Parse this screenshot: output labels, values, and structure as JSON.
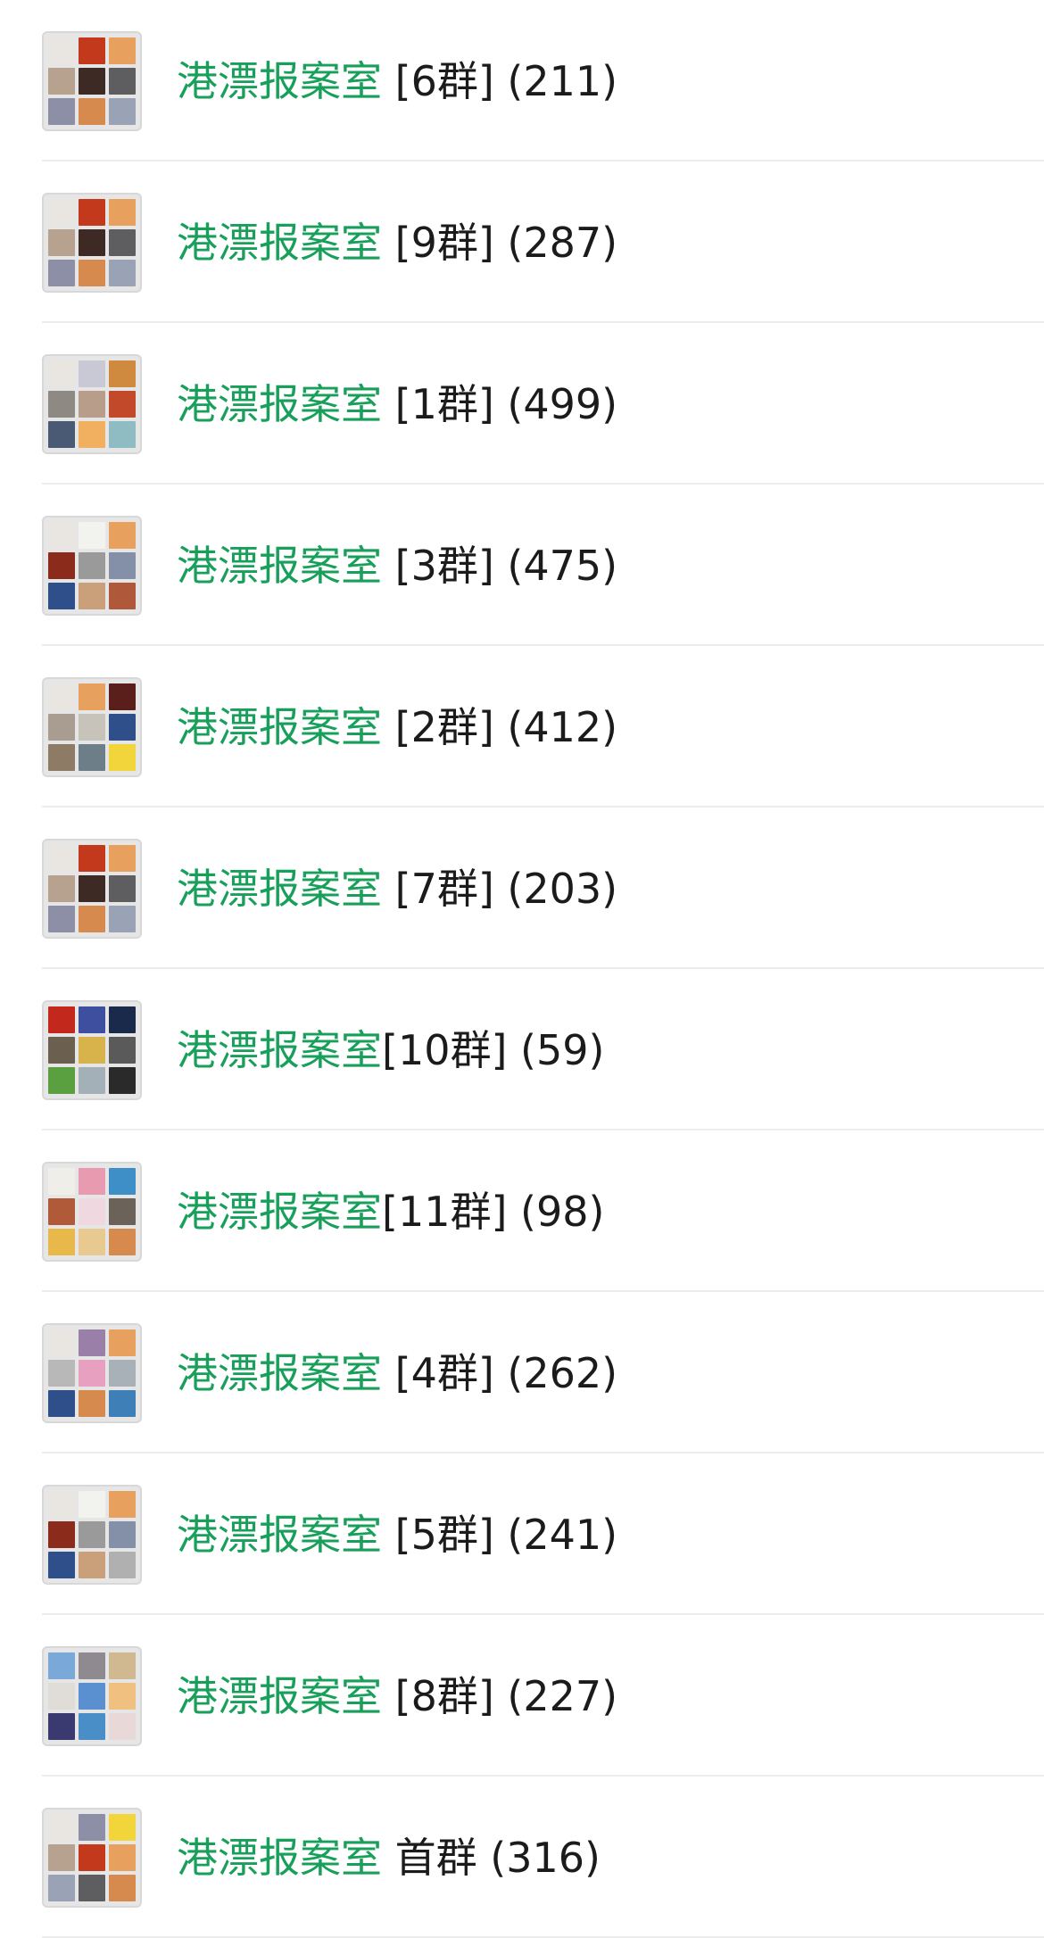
{
  "accent_color": "#18a05b",
  "text_color": "#1b1b1b",
  "groups": [
    {
      "name": "港漂报案室",
      "tag": " [6群]",
      "count": " (211)",
      "avatar_colors": [
        "#e9e6e1",
        "#c2391c",
        "#e7a05e",
        "#b6a28f",
        "#3d2a25",
        "#5e5e60",
        "#8d8fa6",
        "#d68a4e",
        "#9aa3b5"
      ]
    },
    {
      "name": "港漂报案室",
      "tag": " [9群]",
      "count": " (287)",
      "avatar_colors": [
        "#e9e6e1",
        "#c2391c",
        "#e7a05e",
        "#b6a28f",
        "#3d2a25",
        "#5e5e60",
        "#8d8fa6",
        "#d68a4e",
        "#9aa3b5"
      ]
    },
    {
      "name": "港漂报案室",
      "tag": " [1群]",
      "count": " (499)",
      "avatar_colors": [
        "#e9e6e1",
        "#c9c9d6",
        "#d08a3f",
        "#8e8a83",
        "#b89d8a",
        "#c24a2a",
        "#4a5a75",
        "#f0b060",
        "#8fbcc3"
      ]
    },
    {
      "name": "港漂报案室",
      "tag": " [3群]",
      "count": " (475)",
      "avatar_colors": [
        "#e9e6e1",
        "#f2f2ee",
        "#e7a05e",
        "#8b2b1c",
        "#9a9a9a",
        "#8390a8",
        "#2e4f8a",
        "#c9a07a",
        "#b0583a"
      ]
    },
    {
      "name": "港漂报案室",
      "tag": " [2群]",
      "count": " (412)",
      "avatar_colors": [
        "#e9e6e1",
        "#e7a05e",
        "#5a1f1a",
        "#a89d90",
        "#c7c2ba",
        "#2e4f8a",
        "#8d7b66",
        "#6d7e89",
        "#f2d53a"
      ]
    },
    {
      "name": "港漂报案室",
      "tag": " [7群]",
      "count": " (203)",
      "avatar_colors": [
        "#e9e6e1",
        "#c2391c",
        "#e7a05e",
        "#b6a28f",
        "#3d2a25",
        "#5e5e60",
        "#8d8fa6",
        "#d68a4e",
        "#9aa3b5"
      ]
    },
    {
      "name": "港漂报案室",
      "tag": "[10群]",
      "count": " (59)",
      "avatar_colors": [
        "#c2291c",
        "#3f4fa0",
        "#1a2a4a",
        "#6b6050",
        "#d8b24a",
        "#5a5a5a",
        "#5aa040",
        "#a3b0b8",
        "#2a2a2a"
      ]
    },
    {
      "name": "港漂报案室",
      "tag": "[11群]",
      "count": " (98)",
      "avatar_colors": [
        "#f0eee9",
        "#e89bb0",
        "#3e8fc8",
        "#b05a3a",
        "#f0d8e0",
        "#6b6359",
        "#e8b84a",
        "#e8c990",
        "#d68a4e"
      ]
    },
    {
      "name": "港漂报案室",
      "tag": " [4群]",
      "count": " (262)",
      "avatar_colors": [
        "#e9e6e1",
        "#9a7fa8",
        "#e7a05e",
        "#b8b8b8",
        "#e8a0c0",
        "#a8b0b8",
        "#2e4f8a",
        "#d68a4e",
        "#3e7fb8"
      ]
    },
    {
      "name": "港漂报案室",
      "tag": " [5群]",
      "count": " (241)",
      "avatar_colors": [
        "#e9e6e1",
        "#f2f2ee",
        "#e7a05e",
        "#8b2b1c",
        "#9a9a9a",
        "#8390a8",
        "#2e4f8a",
        "#c9a07a",
        "#b0b0b0"
      ]
    },
    {
      "name": "港漂报案室",
      "tag": " [8群]",
      "count": " (227)",
      "avatar_colors": [
        "#7aa8d8",
        "#8e8a90",
        "#d0b890",
        "#e0ddd8",
        "#5a8fd0",
        "#f0c080",
        "#3a3a70",
        "#4a8ec8",
        "#e8d8d8"
      ]
    },
    {
      "name": "港漂报案室",
      "tag": " 首群",
      "count": " (316)",
      "avatar_colors": [
        "#e9e6e1",
        "#8d8fa6",
        "#f2d53a",
        "#b6a28f",
        "#c2391c",
        "#e7a05e",
        "#9aa3b5",
        "#5e5e60",
        "#d68a4e"
      ]
    }
  ]
}
